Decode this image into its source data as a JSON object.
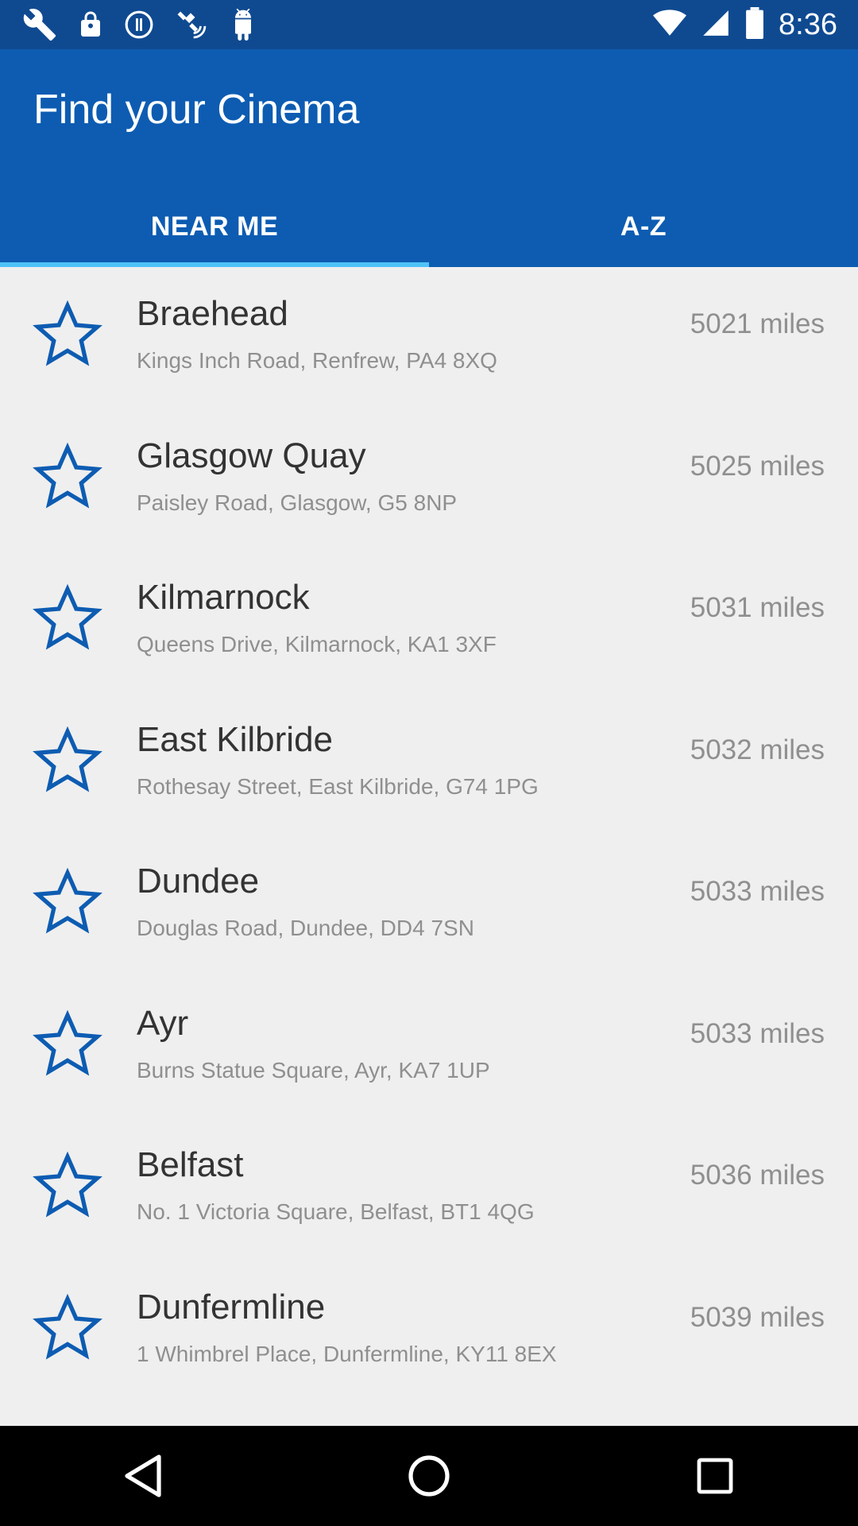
{
  "status_bar": {
    "time": "8:36",
    "icons": [
      "wrench-icon",
      "lock-icon",
      "info-icon",
      "satellite-icon",
      "android-icon",
      "wifi-icon",
      "signal-icon",
      "battery-icon"
    ]
  },
  "header": {
    "title": "Find your Cinema",
    "accent_color": "#0d5cb2",
    "indicator_color": "#4fc3f7"
  },
  "tabs": [
    {
      "label": "NEAR ME",
      "selected": true
    },
    {
      "label": "A-Z",
      "selected": false
    }
  ],
  "cinemas": [
    {
      "name": "Braehead",
      "address": "Kings Inch Road, Renfrew, PA4 8XQ",
      "distance": "5021 miles"
    },
    {
      "name": "Glasgow Quay",
      "address": "Paisley Road, Glasgow, G5 8NP",
      "distance": "5025 miles"
    },
    {
      "name": "Kilmarnock",
      "address": "Queens Drive, Kilmarnock, KA1 3XF",
      "distance": "5031 miles"
    },
    {
      "name": "East Kilbride",
      "address": "Rothesay Street, East Kilbride, G74 1PG",
      "distance": "5032 miles"
    },
    {
      "name": "Dundee",
      "address": "Douglas Road, Dundee, DD4 7SN",
      "distance": "5033 miles"
    },
    {
      "name": "Ayr",
      "address": "Burns Statue Square, Ayr, KA7 1UP",
      "distance": "5033 miles"
    },
    {
      "name": "Belfast",
      "address": "No. 1 Victoria Square, Belfast, BT1 4QG",
      "distance": "5036 miles"
    },
    {
      "name": "Dunfermline",
      "address": "1 Whimbrel Place, Dunfermline, KY11 8EX",
      "distance": "5039 miles"
    }
  ],
  "nav": {
    "icons": [
      "back-icon",
      "home-icon",
      "recents-icon"
    ]
  }
}
